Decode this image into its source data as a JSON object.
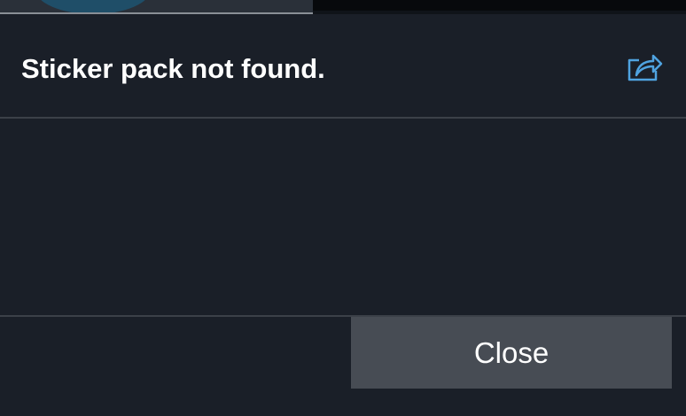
{
  "dialog": {
    "title": "Sticker pack not found.",
    "share_icon": "share-icon",
    "close_label": "Close"
  },
  "colors": {
    "background": "#1a1f28",
    "divider": "#3b4048",
    "title_text": "#ffffff",
    "accent_icon": "#4fa3e0",
    "close_button_bg": "#474c54"
  }
}
